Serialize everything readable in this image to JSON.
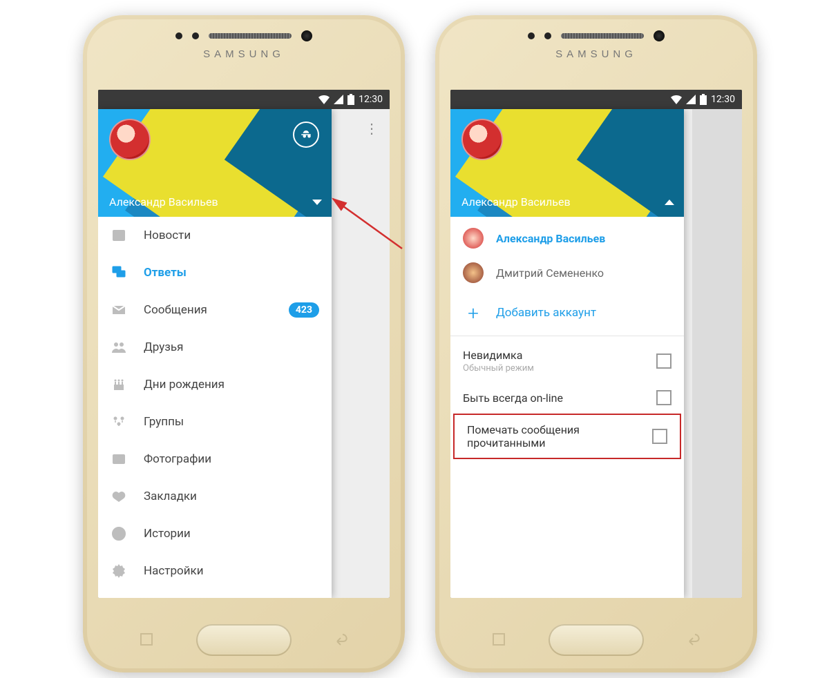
{
  "brand_text": "SAMSUNG",
  "status": {
    "time": "12:30"
  },
  "header": {
    "username": "Александр Васильев"
  },
  "menu": [
    {
      "icon": "news",
      "label": "Новости"
    },
    {
      "icon": "replies",
      "label": "Ответы",
      "active": true
    },
    {
      "icon": "messages",
      "label": "Сообщения",
      "badge": "423"
    },
    {
      "icon": "friends",
      "label": "Друзья"
    },
    {
      "icon": "birthdays",
      "label": "Дни рождения"
    },
    {
      "icon": "groups",
      "label": "Группы"
    },
    {
      "icon": "photos",
      "label": "Фотографии"
    },
    {
      "icon": "bookmarks",
      "label": "Закладки"
    },
    {
      "icon": "stories",
      "label": "Истории"
    },
    {
      "icon": "settings",
      "label": "Настройки"
    }
  ],
  "accounts": [
    {
      "name": "Александр Васильев",
      "primary": true
    },
    {
      "name": "Дмитрий Семененко",
      "primary": false
    }
  ],
  "add_account_label": "Добавить аккаунт",
  "options": [
    {
      "title": "Невидимка",
      "subtitle": "Обычный режим",
      "highlight": false
    },
    {
      "title": "Быть всегда on-line",
      "subtitle": "",
      "highlight": false
    },
    {
      "title": "Помечать сообщения прочитанными",
      "subtitle": "",
      "highlight": true
    }
  ]
}
